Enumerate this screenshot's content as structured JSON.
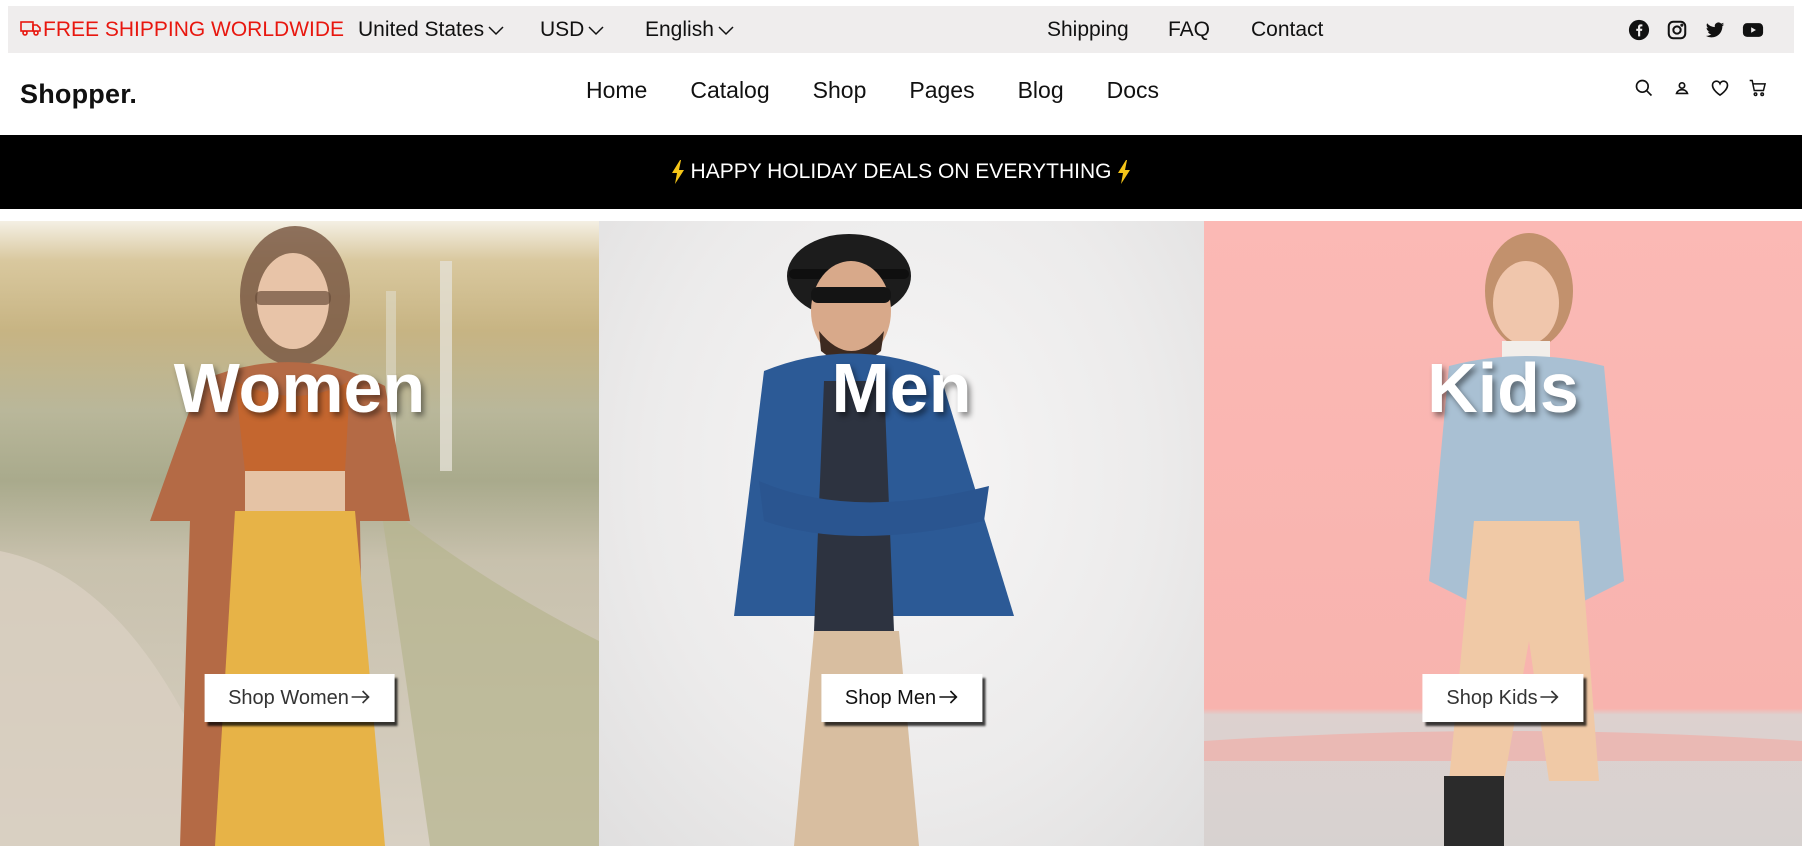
{
  "topbar": {
    "promo": "FREE SHIPPING WORLDWIDE",
    "promo_icon": "truck-icon",
    "country": "United States",
    "currency": "USD",
    "language": "English",
    "links": [
      "Shipping",
      "FAQ",
      "Contact"
    ],
    "social_icons": [
      "facebook-icon",
      "instagram-icon",
      "twitter-icon",
      "youtube-icon"
    ],
    "promo_color": "#e8170f"
  },
  "header": {
    "logo": "Shopper.",
    "nav": [
      "Home",
      "Catalog",
      "Shop",
      "Pages",
      "Blog",
      "Docs"
    ],
    "icons": [
      "search-icon",
      "user-icon",
      "heart-icon",
      "cart-icon"
    ]
  },
  "banner": {
    "text": "HAPPY HOLIDAY DEALS ON EVERYTHING",
    "icon": "lightning-bolt-icon",
    "bolt_color": "#f5c518"
  },
  "categories": [
    {
      "title": "Women",
      "button": "Shop Women"
    },
    {
      "title": "Men",
      "button": "Shop Men"
    },
    {
      "title": "Kids",
      "button": "Shop Kids"
    }
  ]
}
